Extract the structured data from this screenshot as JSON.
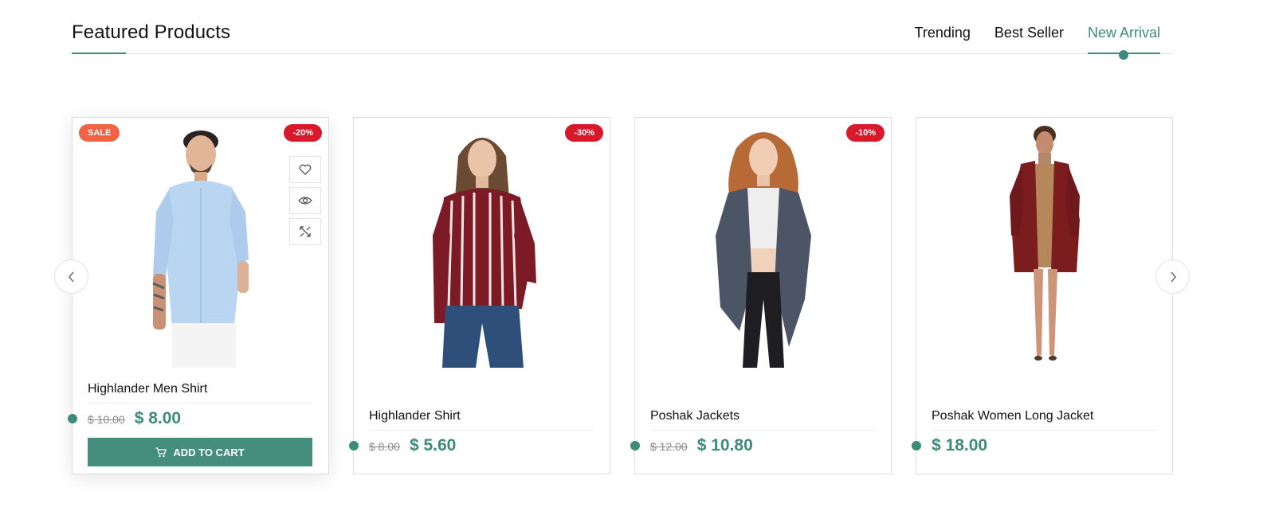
{
  "section": {
    "title": "Featured Products",
    "tabs": [
      {
        "label": "Trending",
        "active": false
      },
      {
        "label": "Best Seller",
        "active": false
      },
      {
        "label": "New Arrival",
        "active": true
      }
    ]
  },
  "colors": {
    "accent": "#3d8b79",
    "sale_badge": "#f06345",
    "discount_badge": "#d8182b"
  },
  "products": [
    {
      "name": "Highlander Men Shirt",
      "old_price": "$ 10.00",
      "new_price": "$ 8.00",
      "sale_badge": "SALE",
      "discount_badge": "-20%",
      "add_to_cart": "ADD TO CART",
      "image": "man-light-blue-shirt"
    },
    {
      "name": "Highlander Shirt",
      "old_price": "$ 8.00",
      "new_price": "$ 5.60",
      "discount_badge": "-30%",
      "image": "woman-maroon-striped-shirt"
    },
    {
      "name": "Poshak Jackets",
      "old_price": "$ 12.00",
      "new_price": "$ 10.80",
      "discount_badge": "-10%",
      "image": "woman-grey-jacket"
    },
    {
      "name": "Poshak Women Long Jacket",
      "new_price": "$ 18.00",
      "image": "woman-maroon-long-jacket"
    }
  ],
  "icons": {
    "wishlist": "heart-icon",
    "quick_view": "eye-icon",
    "compare": "compare-icon",
    "cart": "cart-icon",
    "prev": "chevron-left-icon",
    "next": "chevron-right-icon"
  }
}
